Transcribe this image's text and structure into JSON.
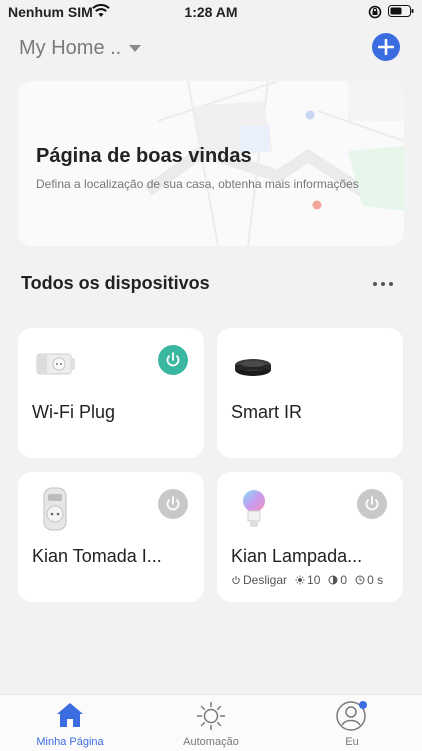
{
  "status_bar": {
    "carrier": "Nenhum SIM",
    "time": "1:28 AM"
  },
  "header": {
    "home_name": "My Home ..",
    "add_icon": "plus-icon"
  },
  "welcome": {
    "title": "Página de boas vindas",
    "subtitle": "Defina a localização de sua casa, obtenha mais informações"
  },
  "devices_section": {
    "title": "Todos os dispositivos"
  },
  "devices": [
    {
      "name": "Wi-Fi Plug",
      "power": "on",
      "icon": "smart-plug-icon"
    },
    {
      "name": "Smart IR",
      "icon": "ir-remote-icon"
    },
    {
      "name": "Kian Tomada I...",
      "power": "off",
      "icon": "outlet-plug-icon"
    },
    {
      "name": "Kian Lampada...",
      "power": "off",
      "icon": "bulb-icon",
      "status": {
        "state": "Desligar",
        "brightness": "10",
        "temperature": "0",
        "timer": "0 s"
      }
    }
  ],
  "tabs": [
    {
      "label": "Minha Página",
      "icon": "home-icon",
      "active": true
    },
    {
      "label": "Automação",
      "icon": "sun-icon",
      "active": false
    },
    {
      "label": "Eu",
      "icon": "user-icon",
      "active": false
    }
  ],
  "colors": {
    "accent": "#3c6de0",
    "power_on": "#3ab7a1",
    "power_off": "#c8c8c8",
    "background": "#f2f2f2"
  }
}
